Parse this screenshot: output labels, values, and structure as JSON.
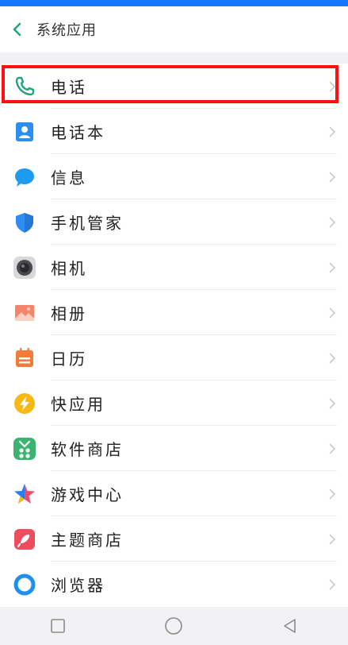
{
  "header": {
    "title": "系统应用"
  },
  "items": [
    {
      "label": "电话",
      "icon": "phone-icon"
    },
    {
      "label": "电话本",
      "icon": "contacts-icon"
    },
    {
      "label": "信息",
      "icon": "message-icon"
    },
    {
      "label": "手机管家",
      "icon": "shield-icon"
    },
    {
      "label": "相机",
      "icon": "camera-icon"
    },
    {
      "label": "相册",
      "icon": "gallery-icon"
    },
    {
      "label": "日历",
      "icon": "calendar-icon"
    },
    {
      "label": "快应用",
      "icon": "lightning-icon"
    },
    {
      "label": "软件商店",
      "icon": "app-store-icon"
    },
    {
      "label": "游戏中心",
      "icon": "star-icon"
    },
    {
      "label": "主题商店",
      "icon": "theme-store-icon"
    },
    {
      "label": "浏览器",
      "icon": "browser-icon"
    }
  ],
  "colors": {
    "accent": "#21a37d",
    "highlight": "#ff1010",
    "statusbar": "#1677ff"
  }
}
